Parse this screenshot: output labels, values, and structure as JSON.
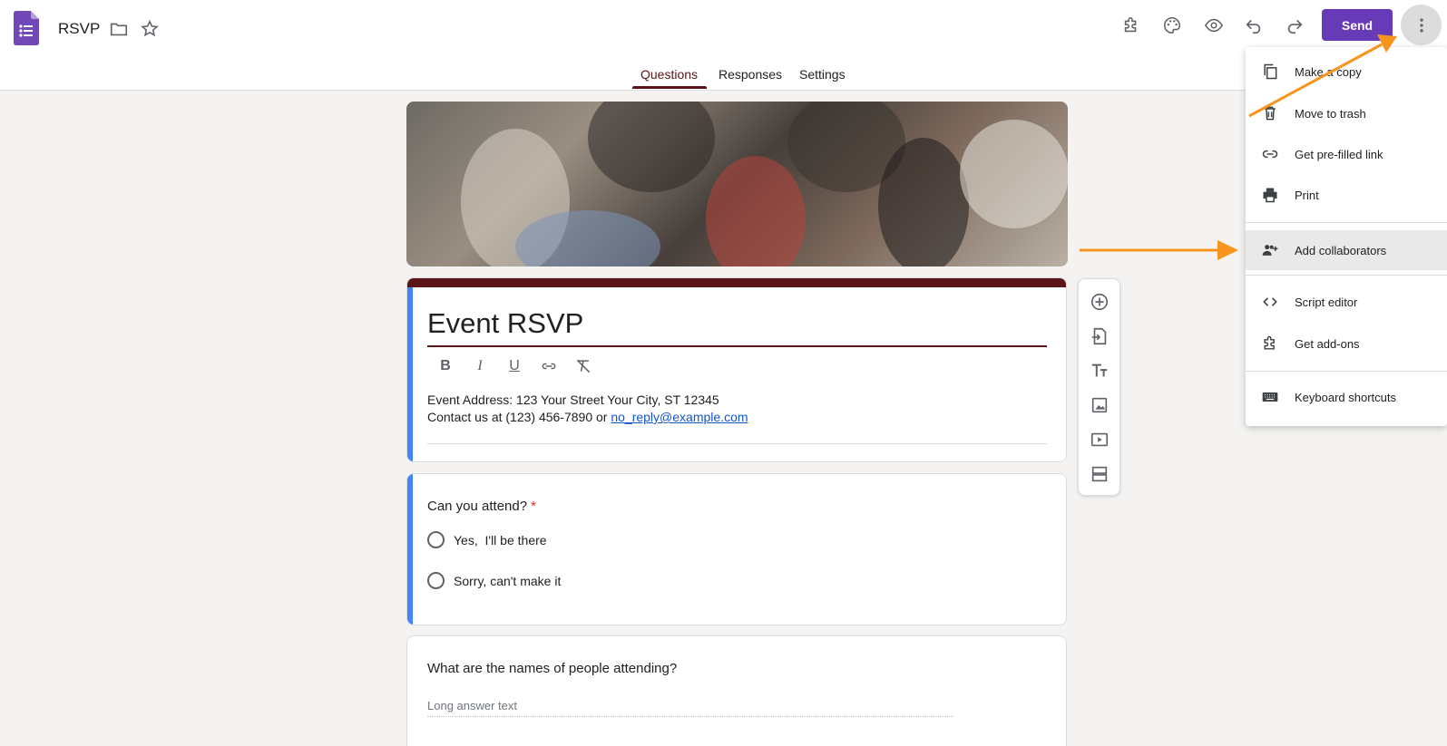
{
  "app": {
    "title": "RSVP",
    "accent": "#673ab7",
    "theme_color": "#5b1417"
  },
  "header": {
    "icons": [
      "folder-icon",
      "star-icon",
      "addons-icon",
      "palette-icon",
      "preview-icon",
      "undo-icon",
      "redo-icon"
    ],
    "send_label": "Send",
    "more_icon": "more-vert-icon"
  },
  "tabs": [
    {
      "label": "Questions",
      "active": true
    },
    {
      "label": "Responses",
      "active": false
    },
    {
      "label": "Settings",
      "active": false
    }
  ],
  "form": {
    "title": "Event RSVP",
    "description_line1": "Event Address: 123 Your Street Your City, ST 12345",
    "description_line2_prefix": "Contact us at (123) 456-7890 or ",
    "email": "no_reply@example.com",
    "format_buttons": [
      "B",
      "I",
      "U",
      "link-icon",
      "clear-format-icon"
    ]
  },
  "questions": [
    {
      "title": "Can you attend?",
      "required": true,
      "required_mark": "*",
      "options": [
        "Yes,  I'll be there",
        "Sorry, can't make it"
      ]
    },
    {
      "title": "What are the names of people attending?",
      "placeholder": "Long answer text"
    }
  ],
  "side_toolbar": [
    "add-question-icon",
    "import-questions-icon",
    "add-title-icon",
    "add-image-icon",
    "add-video-icon",
    "add-section-icon"
  ],
  "menu": {
    "items": [
      {
        "label": "Make a copy",
        "icon": "copy-icon"
      },
      {
        "label": "Move to trash",
        "icon": "trash-icon"
      },
      {
        "label": "Get pre-filled link",
        "icon": "link-icon"
      },
      {
        "label": "Print",
        "icon": "print-icon"
      },
      {
        "label": "Add collaborators",
        "icon": "add-people-icon",
        "highlighted": true
      },
      {
        "label": "Script editor",
        "icon": "code-icon"
      },
      {
        "label": "Get add-ons",
        "icon": "addons-icon"
      },
      {
        "label": "Keyboard shortcuts",
        "icon": "keyboard-icon"
      }
    ]
  },
  "annotation_color": "#f7941d"
}
